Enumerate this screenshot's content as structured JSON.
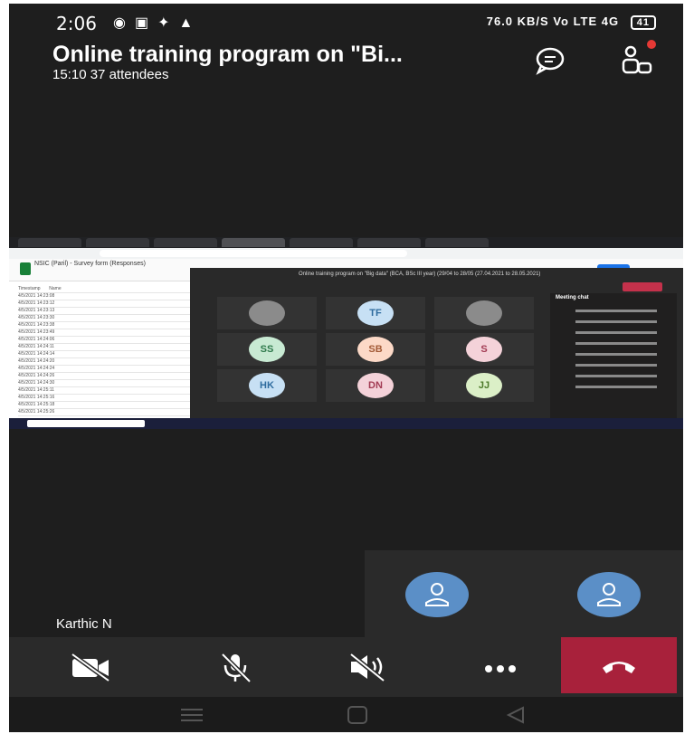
{
  "status_bar": {
    "time": "2:06",
    "right_text": "76.0 KB/S  Vo LTE  4G",
    "battery": "41"
  },
  "meeting": {
    "title": "Online training program on \"Bi...",
    "duration": "15:10",
    "attendees": "37 attendees"
  },
  "icons": [
    "chat-icon",
    "participants-icon",
    "camera-off-icon",
    "mic-off-icon",
    "speaker-off-icon",
    "more-icon",
    "end-call-icon"
  ],
  "self_name": "Karthic N",
  "shared_screen": {
    "sheet_title": "NSIC (Paril) - Survey form (Responses)",
    "teams_title": "Online training program on \"Big data\" (BCA, BSc III year) (29/04 to 28/05 (27.04.2021 to 28.05.2021)",
    "chat_title": "Meeting chat",
    "tiles": [
      {
        "initials": ""
      },
      {
        "initials": "TF"
      },
      {
        "initials": ""
      },
      {
        "initials": "SS"
      },
      {
        "initials": "SB"
      },
      {
        "initials": "S"
      },
      {
        "initials": "HK"
      },
      {
        "initials": "DN"
      },
      {
        "initials": "JJ"
      }
    ]
  },
  "colors": {
    "end_call": "#a8213b",
    "avatar": "#5b8fc7",
    "background": "#1e1e1e"
  }
}
